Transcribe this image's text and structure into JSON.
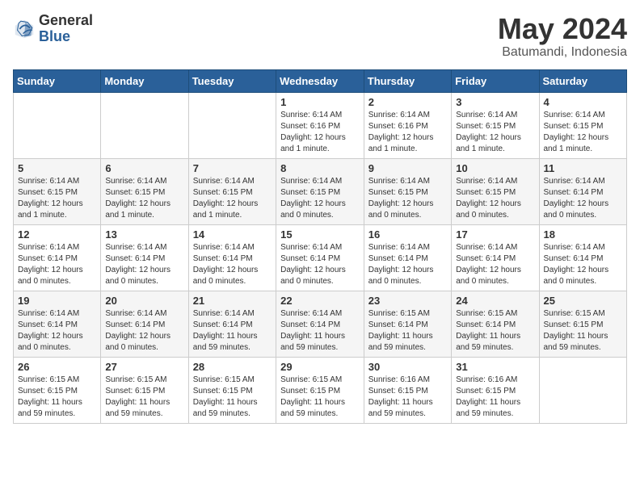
{
  "logo": {
    "general": "General",
    "blue": "Blue"
  },
  "header": {
    "month": "May 2024",
    "location": "Batumandi, Indonesia"
  },
  "weekdays": [
    "Sunday",
    "Monday",
    "Tuesday",
    "Wednesday",
    "Thursday",
    "Friday",
    "Saturday"
  ],
  "weeks": [
    [
      {
        "day": "",
        "info": ""
      },
      {
        "day": "",
        "info": ""
      },
      {
        "day": "",
        "info": ""
      },
      {
        "day": "1",
        "info": "Sunrise: 6:14 AM\nSunset: 6:16 PM\nDaylight: 12 hours and 1 minute."
      },
      {
        "day": "2",
        "info": "Sunrise: 6:14 AM\nSunset: 6:16 PM\nDaylight: 12 hours and 1 minute."
      },
      {
        "day": "3",
        "info": "Sunrise: 6:14 AM\nSunset: 6:15 PM\nDaylight: 12 hours and 1 minute."
      },
      {
        "day": "4",
        "info": "Sunrise: 6:14 AM\nSunset: 6:15 PM\nDaylight: 12 hours and 1 minute."
      }
    ],
    [
      {
        "day": "5",
        "info": "Sunrise: 6:14 AM\nSunset: 6:15 PM\nDaylight: 12 hours and 1 minute."
      },
      {
        "day": "6",
        "info": "Sunrise: 6:14 AM\nSunset: 6:15 PM\nDaylight: 12 hours and 1 minute."
      },
      {
        "day": "7",
        "info": "Sunrise: 6:14 AM\nSunset: 6:15 PM\nDaylight: 12 hours and 1 minute."
      },
      {
        "day": "8",
        "info": "Sunrise: 6:14 AM\nSunset: 6:15 PM\nDaylight: 12 hours and 0 minutes."
      },
      {
        "day": "9",
        "info": "Sunrise: 6:14 AM\nSunset: 6:15 PM\nDaylight: 12 hours and 0 minutes."
      },
      {
        "day": "10",
        "info": "Sunrise: 6:14 AM\nSunset: 6:15 PM\nDaylight: 12 hours and 0 minutes."
      },
      {
        "day": "11",
        "info": "Sunrise: 6:14 AM\nSunset: 6:14 PM\nDaylight: 12 hours and 0 minutes."
      }
    ],
    [
      {
        "day": "12",
        "info": "Sunrise: 6:14 AM\nSunset: 6:14 PM\nDaylight: 12 hours and 0 minutes."
      },
      {
        "day": "13",
        "info": "Sunrise: 6:14 AM\nSunset: 6:14 PM\nDaylight: 12 hours and 0 minutes."
      },
      {
        "day": "14",
        "info": "Sunrise: 6:14 AM\nSunset: 6:14 PM\nDaylight: 12 hours and 0 minutes."
      },
      {
        "day": "15",
        "info": "Sunrise: 6:14 AM\nSunset: 6:14 PM\nDaylight: 12 hours and 0 minutes."
      },
      {
        "day": "16",
        "info": "Sunrise: 6:14 AM\nSunset: 6:14 PM\nDaylight: 12 hours and 0 minutes."
      },
      {
        "day": "17",
        "info": "Sunrise: 6:14 AM\nSunset: 6:14 PM\nDaylight: 12 hours and 0 minutes."
      },
      {
        "day": "18",
        "info": "Sunrise: 6:14 AM\nSunset: 6:14 PM\nDaylight: 12 hours and 0 minutes."
      }
    ],
    [
      {
        "day": "19",
        "info": "Sunrise: 6:14 AM\nSunset: 6:14 PM\nDaylight: 12 hours and 0 minutes."
      },
      {
        "day": "20",
        "info": "Sunrise: 6:14 AM\nSunset: 6:14 PM\nDaylight: 12 hours and 0 minutes."
      },
      {
        "day": "21",
        "info": "Sunrise: 6:14 AM\nSunset: 6:14 PM\nDaylight: 11 hours and 59 minutes."
      },
      {
        "day": "22",
        "info": "Sunrise: 6:14 AM\nSunset: 6:14 PM\nDaylight: 11 hours and 59 minutes."
      },
      {
        "day": "23",
        "info": "Sunrise: 6:15 AM\nSunset: 6:14 PM\nDaylight: 11 hours and 59 minutes."
      },
      {
        "day": "24",
        "info": "Sunrise: 6:15 AM\nSunset: 6:14 PM\nDaylight: 11 hours and 59 minutes."
      },
      {
        "day": "25",
        "info": "Sunrise: 6:15 AM\nSunset: 6:15 PM\nDaylight: 11 hours and 59 minutes."
      }
    ],
    [
      {
        "day": "26",
        "info": "Sunrise: 6:15 AM\nSunset: 6:15 PM\nDaylight: 11 hours and 59 minutes."
      },
      {
        "day": "27",
        "info": "Sunrise: 6:15 AM\nSunset: 6:15 PM\nDaylight: 11 hours and 59 minutes."
      },
      {
        "day": "28",
        "info": "Sunrise: 6:15 AM\nSunset: 6:15 PM\nDaylight: 11 hours and 59 minutes."
      },
      {
        "day": "29",
        "info": "Sunrise: 6:15 AM\nSunset: 6:15 PM\nDaylight: 11 hours and 59 minutes."
      },
      {
        "day": "30",
        "info": "Sunrise: 6:16 AM\nSunset: 6:15 PM\nDaylight: 11 hours and 59 minutes."
      },
      {
        "day": "31",
        "info": "Sunrise: 6:16 AM\nSunset: 6:15 PM\nDaylight: 11 hours and 59 minutes."
      },
      {
        "day": "",
        "info": ""
      }
    ]
  ]
}
